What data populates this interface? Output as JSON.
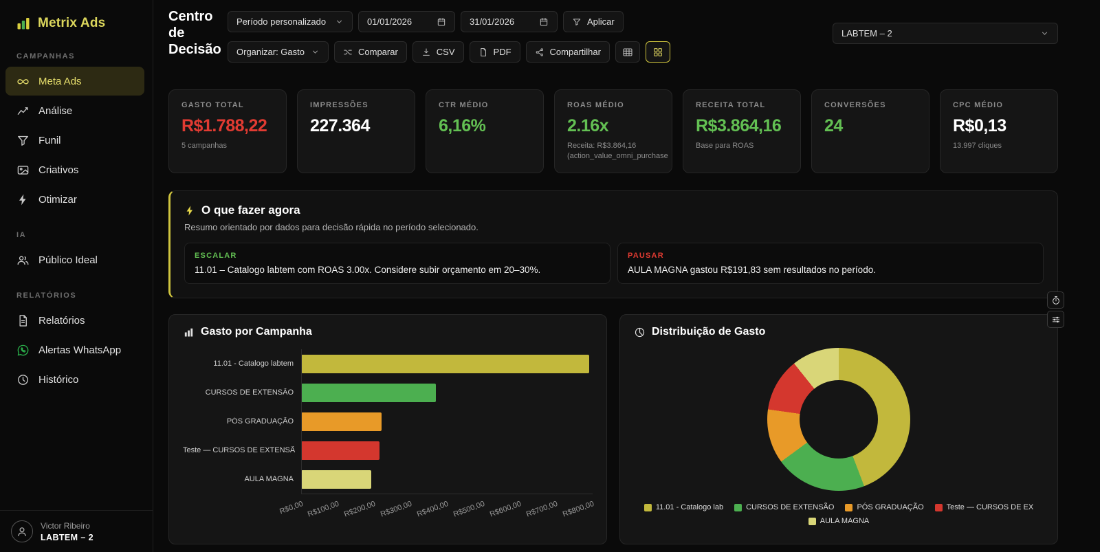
{
  "app": {
    "title": "Metrix Ads"
  },
  "sidebar": {
    "sections": [
      {
        "label": "CAMPANHAS",
        "items": [
          {
            "id": "meta-ads",
            "label": "Meta Ads",
            "icon": "meta",
            "active": true
          },
          {
            "id": "analise",
            "label": "Análise",
            "icon": "chart-line",
            "active": false
          },
          {
            "id": "funil",
            "label": "Funil",
            "icon": "funnel",
            "active": false
          },
          {
            "id": "criativos",
            "label": "Criativos",
            "icon": "image",
            "active": false
          },
          {
            "id": "otimizar",
            "label": "Otimizar",
            "icon": "bolt",
            "active": false
          }
        ]
      },
      {
        "label": "IA",
        "items": [
          {
            "id": "publico-ideal",
            "label": "Público Ideal",
            "icon": "people",
            "active": false
          }
        ]
      },
      {
        "label": "RELATÓRIOS",
        "items": [
          {
            "id": "relatorios",
            "label": "Relatórios",
            "icon": "document",
            "active": false
          },
          {
            "id": "alertas-whatsapp",
            "label": "Alertas WhatsApp",
            "icon": "whatsapp",
            "active": false,
            "icon_color": "#2bb24c"
          },
          {
            "id": "historico",
            "label": "Histórico",
            "icon": "clock",
            "active": false
          }
        ]
      }
    ],
    "user": {
      "name": "Victor Ribeiro",
      "org": "LABTEM – 2"
    }
  },
  "header": {
    "title": "Centro de Decisão",
    "period_select": "Período personalizado",
    "date_from": "01/01/2026",
    "date_to": "31/01/2026",
    "apply_label": "Aplicar",
    "organize_select": "Organizar: Gasto",
    "compare_label": "Comparar",
    "csv_label": "CSV",
    "pdf_label": "PDF",
    "share_label": "Compartilhar",
    "account_select": "LABTEM – 2"
  },
  "kpis": [
    {
      "id": "gasto-total",
      "label": "GASTO TOTAL",
      "value": "R$1.788,22",
      "color": "#e23b32",
      "sub": "5 campanhas"
    },
    {
      "id": "impressoes",
      "label": "IMPRESSÕES",
      "value": "227.364",
      "color": "#ffffff",
      "sub": ""
    },
    {
      "id": "ctr-medio",
      "label": "CTR MÉDIO",
      "value": "6,16%",
      "color": "#63c053",
      "sub": ""
    },
    {
      "id": "roas-medio",
      "label": "ROAS MÉDIO",
      "value": "2.16x",
      "color": "#63c053",
      "sub": "Receita: R$3.864,16 (action_value_omni_purchase"
    },
    {
      "id": "receita-total",
      "label": "RECEITA TOTAL",
      "value": "R$3.864,16",
      "color": "#63c053",
      "sub": "Base para ROAS"
    },
    {
      "id": "conversoes",
      "label": "CONVERSÕES",
      "value": "24",
      "color": "#63c053",
      "sub": ""
    },
    {
      "id": "cpc-medio",
      "label": "CPC MÉDIO",
      "value": "R$0,13",
      "color": "#ffffff",
      "sub": "13.997 cliques"
    }
  ],
  "decision": {
    "title": "O que fazer agora",
    "subtitle": "Resumo orientado por dados para decisão rápida no período selecionado.",
    "accent_color": "#cfc43e",
    "items": [
      {
        "tag": "ESCALAR",
        "tag_color": "#63c053",
        "text": "11.01 – Catalogo labtem com ROAS 3.00x. Considere subir orçamento em 20–30%."
      },
      {
        "tag": "PAUSAR",
        "tag_color": "#e23b32",
        "text": "AULA MAGNA gastou R$191,83 sem resultados no período."
      }
    ]
  },
  "chart_data": [
    {
      "type": "bar",
      "orientation": "horizontal",
      "title": "Gasto por Campanha",
      "categories": [
        "11.01 - Catalogo labtem",
        "CURSOS DE EXTENSÃO",
        "PÓS GRADUAÇÃO",
        "Teste — CURSOS DE EXTENSÃ",
        "AULA MAGNA"
      ],
      "values": [
        790,
        370,
        220,
        215,
        191.83
      ],
      "colors": [
        "#c2b83c",
        "#4caf50",
        "#e89a28",
        "#d4372e",
        "#d9d678"
      ],
      "xlabel": "",
      "ylabel": "",
      "xlim": [
        0,
        800
      ],
      "x_ticks": [
        "R$0,00",
        "R$100,00",
        "R$200,00",
        "R$300,00",
        "R$400,00",
        "R$500,00",
        "R$600,00",
        "R$700,00",
        "R$800,00"
      ],
      "grid": false
    },
    {
      "type": "pie",
      "donut": true,
      "title": "Distribuição de Gasto",
      "labels": [
        "11.01 - Catalogo lab",
        "CURSOS DE EXTENSÃO",
        "PÓS GRADUAÇÃO",
        "Teste — CURSOS DE EX",
        "AULA MAGNA"
      ],
      "values": [
        790,
        370,
        220,
        215,
        191.83
      ],
      "colors": [
        "#c2b83c",
        "#4caf50",
        "#e89a28",
        "#d4372e",
        "#d9d678"
      ],
      "legend_position": "bottom"
    }
  ],
  "float_buttons": [
    {
      "id": "timer",
      "icon": "stopwatch"
    },
    {
      "id": "filters",
      "icon": "sliders"
    }
  ]
}
